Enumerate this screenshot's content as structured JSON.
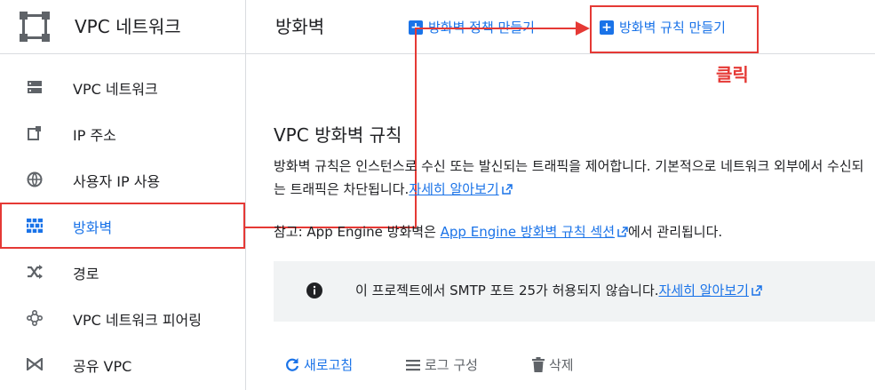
{
  "sidebar": {
    "title": "VPC 네트워크",
    "items": [
      {
        "label": "VPC 네트워크",
        "icon": "vpc-network-icon"
      },
      {
        "label": "IP 주소",
        "icon": "ip-address-icon"
      },
      {
        "label": "사용자 IP 사용",
        "icon": "globe-icon"
      },
      {
        "label": "방화벽",
        "icon": "firewall-icon",
        "active": true
      },
      {
        "label": "경로",
        "icon": "routes-icon"
      },
      {
        "label": "VPC 네트워크 피어링",
        "icon": "peering-icon"
      },
      {
        "label": "공유 VPC",
        "icon": "shared-vpc-icon"
      }
    ]
  },
  "header": {
    "title": "방화벽",
    "create_policy": "방화벽 정책 만들기",
    "create_rule": "방화벽 규칙 만들기"
  },
  "annotation": {
    "click_label": "클릭",
    "color": "#e53935"
  },
  "main": {
    "section_title": "VPC 방화벽 규칙",
    "description": "방화벽 규칙은 인스턴스로 수신 또는 발신되는 트래픽을 제어합니다. 기본적으로 네트워크 외부에서 수신되는 트래픽은 차단됩니다.",
    "learn_more": "자세히 알아보기",
    "note_prefix": "참고: App Engine 방화벽은 ",
    "note_link": "App Engine 방화벽 규칙 섹션",
    "note_suffix": "에서 관리됩니다."
  },
  "info_banner": {
    "text": "이 프로젝트에서 SMTP 포트 25가 허용되지 않습니다.",
    "learn_more": "자세히 알아보기"
  },
  "toolbar": {
    "refresh": "새로고침",
    "configure_logs": "로그 구성",
    "delete": "삭제"
  },
  "colors": {
    "accent": "#1a73e8",
    "highlight": "#e53935",
    "text": "#202124",
    "muted": "#5f6368"
  }
}
